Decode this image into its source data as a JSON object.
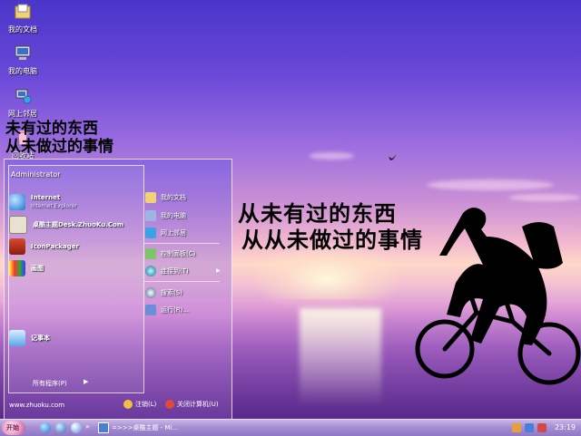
{
  "desktop": {
    "icons": [
      {
        "label": "我的文档",
        "icon": "my-documents-icon"
      },
      {
        "label": "我的电脑",
        "icon": "my-computer-icon"
      },
      {
        "label": "网上邻居",
        "icon": "network-places-icon"
      },
      {
        "label": "回收站",
        "icon": "recycle-bin-icon"
      }
    ],
    "wallpaper_text": [
      "从未有过的东西",
      "从从未做过的事情"
    ]
  },
  "start_menu": {
    "user": "Administrator",
    "pinned": [
      {
        "label": "Internet",
        "sub": "Internet Explorer"
      },
      {
        "label": "桌酷主题Desk.ZhuoKu.Com",
        "sub": ""
      },
      {
        "label": "IconPackager",
        "sub": ""
      },
      {
        "label": "画图",
        "sub": ""
      },
      {
        "label": "记事本",
        "sub": ""
      }
    ],
    "overlay_text": [
      "未有过的东西",
      "从未做过的事情"
    ],
    "all_programs": "所有程序(P)",
    "url": "www.zhuoku.com",
    "right": {
      "documents": "我的文档",
      "computer": "我的电脑",
      "network": "网上邻居",
      "control_panel": "控制面板(C)",
      "connect_to": "连接到(T)",
      "search": "搜索(S)",
      "run": "运行(R)..."
    },
    "logoff": "注销(L)",
    "shutdown": "关闭计算机(U)"
  },
  "taskbar": {
    "start_label": "开始",
    "chevron": "»",
    "task_label": "=>>>桌酷主题 - Mi...",
    "clock": "23:19"
  },
  "colors": {
    "taskbar": "#a68fd3",
    "menu_border": "#ffffff"
  }
}
